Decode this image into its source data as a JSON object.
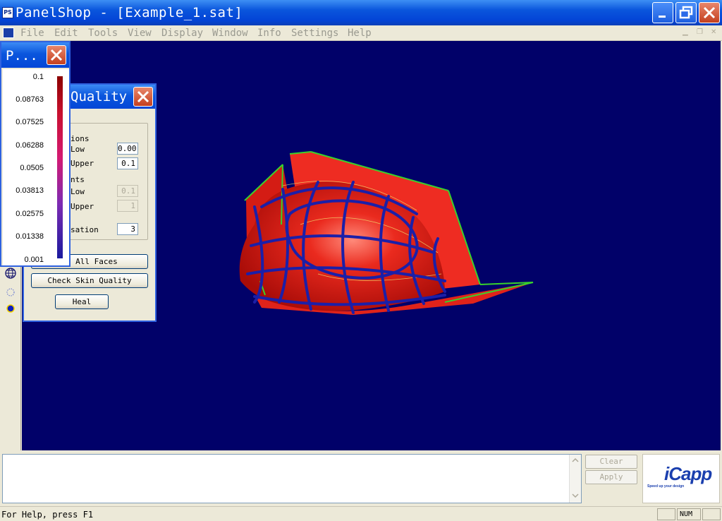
{
  "window": {
    "title": "PanelShop - [Example_1.sat]",
    "app_icon_text": "PS"
  },
  "menu": {
    "items": [
      "File",
      "Edit",
      "Tools",
      "View",
      "Display",
      "Window",
      "Info",
      "Settings",
      "Help"
    ]
  },
  "legend_panel": {
    "title": "P...",
    "values": [
      "0.1",
      "0.08763",
      "0.07525",
      "0.06288",
      "0.0505",
      "0.03813",
      "0.02575",
      "0.01338",
      "0.001"
    ]
  },
  "quality_panel": {
    "title": "Quality",
    "group1_label": "ions",
    "low_label": "Low",
    "low_value": "0.00",
    "upper_label": "Upper",
    "upper_value": "0.1",
    "group2_label": "nts",
    "low2_label": "Low",
    "low2_value": "0.1",
    "upper2_label": "Upper",
    "upper2_value": "1",
    "sation_label": "sation",
    "sation_value": "3",
    "select_all_button": "ct All Faces",
    "check_skin_button": "Check Skin Quality",
    "heal_button": "Heal"
  },
  "bottom": {
    "clear_button": "Clear",
    "apply_button": "Apply",
    "logo_text": "iCapp",
    "logo_tagline": "Speed up your design"
  },
  "statusbar": {
    "help_text": "For Help, press F1",
    "num_indicator": "NUM"
  },
  "colors": {
    "viewport_bg": "#010169",
    "surface": "#e8201a",
    "patch_lines": "#1b1fa8",
    "edges": "#39d12c"
  }
}
